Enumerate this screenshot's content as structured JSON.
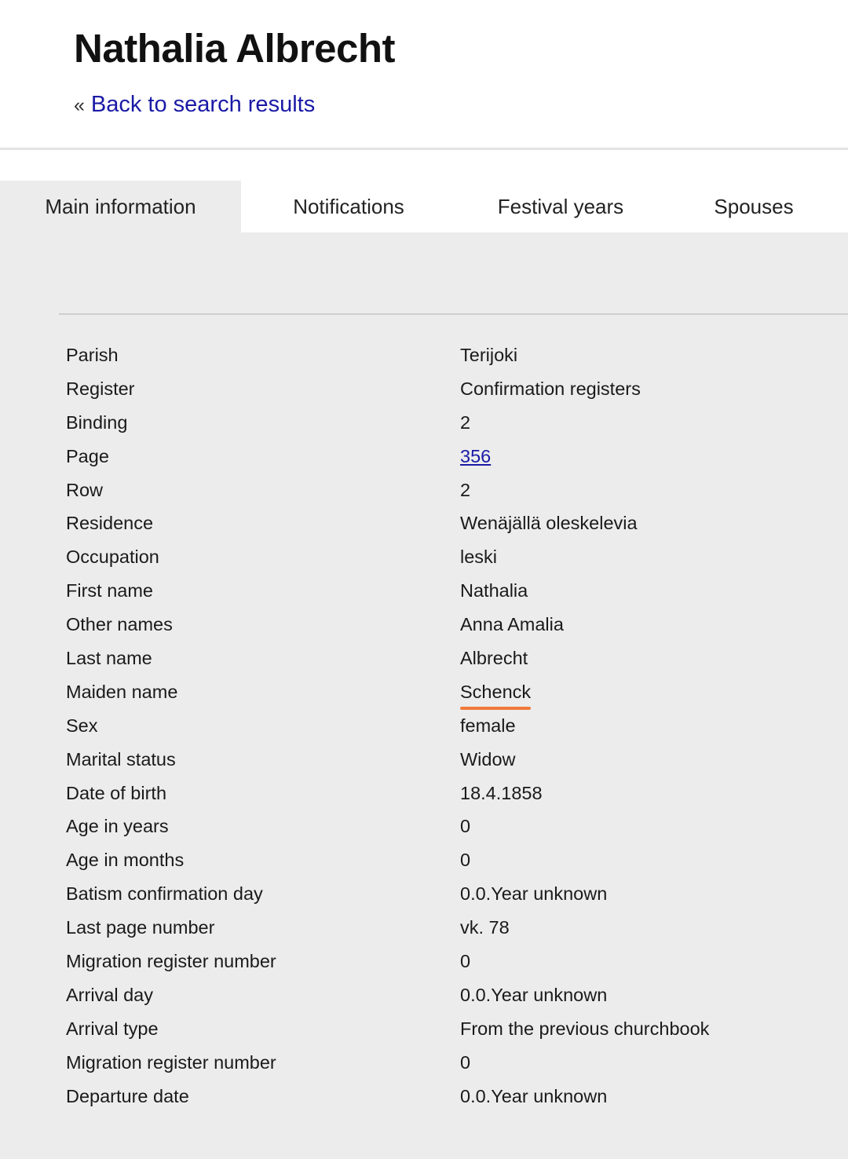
{
  "header": {
    "title": "Nathalia Albrecht",
    "back_prefix": "«",
    "back_link": "Back to search results"
  },
  "tabs": [
    {
      "label": "Main information",
      "active": true
    },
    {
      "label": "Notifications",
      "active": false
    },
    {
      "label": "Festival years",
      "active": false
    },
    {
      "label": "Spouses",
      "active": false
    }
  ],
  "colors": {
    "link": "#1a1aa6",
    "highlight": "#f07a3a",
    "content_background": "#ececec"
  },
  "rows": [
    {
      "label": "Parish",
      "value": "Terijoki"
    },
    {
      "label": "Register",
      "value": "Confirmation registers"
    },
    {
      "label": "Binding",
      "value": "2"
    },
    {
      "label": "Page",
      "value": "356",
      "link": true
    },
    {
      "label": "Row",
      "value": "2"
    },
    {
      "label": "Residence",
      "value": "Wenäjällä oleskelevia"
    },
    {
      "label": "Occupation",
      "value": "leski"
    },
    {
      "label": "First name",
      "value": "Nathalia"
    },
    {
      "label": "Other names",
      "value": "Anna Amalia"
    },
    {
      "label": "Last name",
      "value": "Albrecht"
    },
    {
      "label": "Maiden name",
      "value": "Schenck",
      "highlighted": true
    },
    {
      "label": "Sex",
      "value": "female"
    },
    {
      "label": "Marital status",
      "value": "Widow"
    },
    {
      "label": "Date of birth",
      "value": "18.4.1858"
    },
    {
      "label": "Age in years",
      "value": "0"
    },
    {
      "label": "Age in months",
      "value": "0"
    },
    {
      "label": "Batism confirmation day",
      "value": "0.0.Year unknown"
    },
    {
      "label": "Last page number",
      "value": "vk. 78"
    },
    {
      "label": "Migration register number",
      "value": "0"
    },
    {
      "label": "Arrival day",
      "value": "0.0.Year unknown"
    },
    {
      "label": "Arrival type",
      "value": "From the previous churchbook"
    },
    {
      "label": "Migration register number",
      "value": "0"
    },
    {
      "label": "Departure date",
      "value": "0.0.Year unknown"
    }
  ]
}
